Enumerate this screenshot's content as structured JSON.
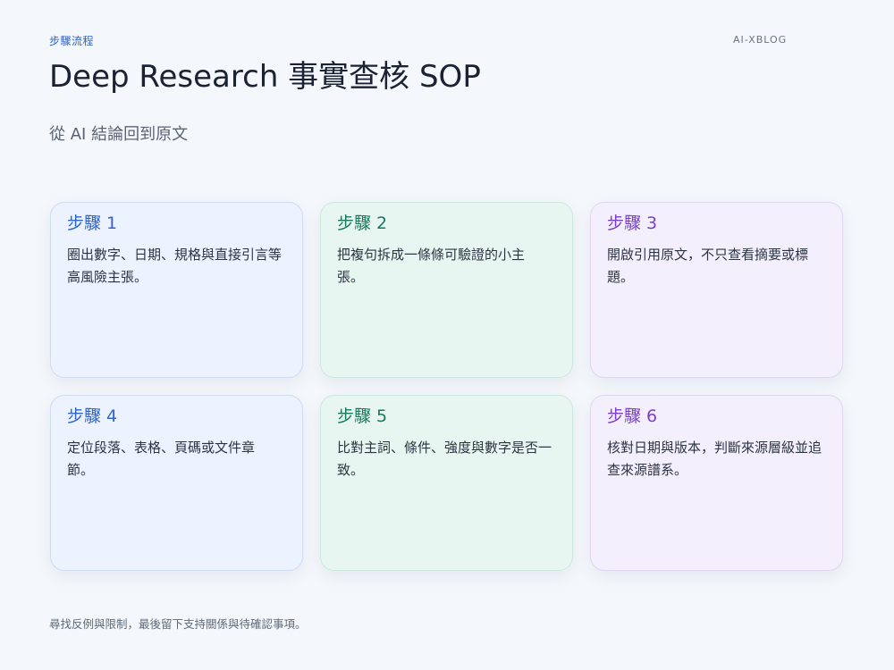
{
  "header": {
    "eyebrow": "步驟流程",
    "brand": "AI-XBLOG",
    "title": "Deep Research 事實查核 SOP",
    "subtitle": "從 AI 結論回到原文"
  },
  "steps": [
    {
      "title": "步驟 1",
      "body": "圈出數字、日期、規格與直接引言等\n高風險主張。"
    },
    {
      "title": "步驟 2",
      "body": "把複句拆成一條條可驗證的小主\n張。"
    },
    {
      "title": "步驟 3",
      "body": "開啟引用原文，不只查看摘要或標\n題。"
    },
    {
      "title": "步驟 4",
      "body": "定位段落、表格、頁碼或文件章\n節。"
    },
    {
      "title": "步驟 5",
      "body": "比對主詞、條件、強度與數字是否一\n致。"
    },
    {
      "title": "步驟 6",
      "body": "核對日期與版本，判斷來源層級並追\n查來源譜系。"
    }
  ],
  "footer": {
    "note": "尋找反例與限制，最後留下支持關係與待確認事項。"
  },
  "colors": {
    "background": "#f4f7fb",
    "blue_accent": "#2f64c8",
    "green_accent": "#17795e",
    "purple_accent": "#7a40c8"
  }
}
